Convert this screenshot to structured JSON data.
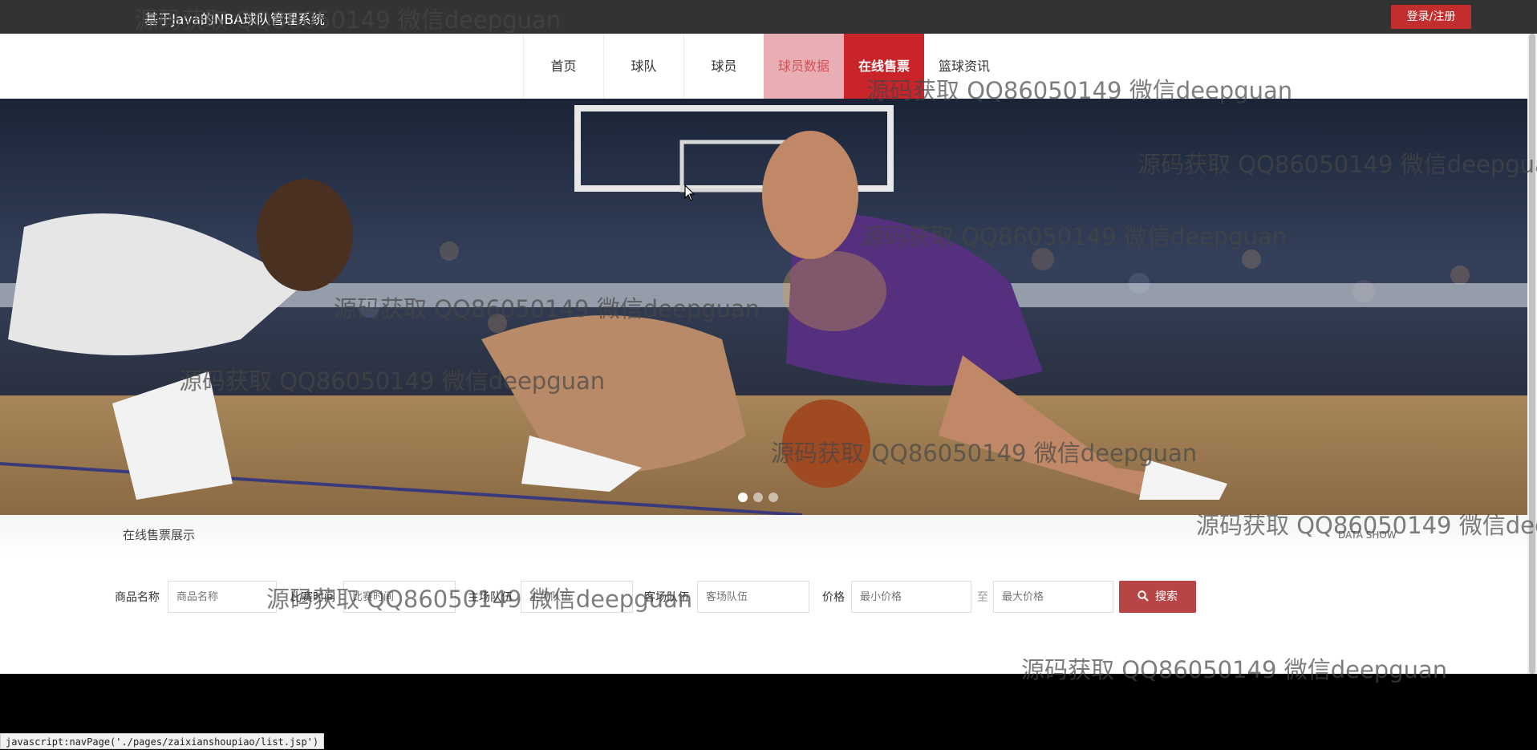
{
  "header": {
    "title": "基于Java的NBA球队管理系统",
    "login_label": "登录/注册"
  },
  "nav": {
    "items": [
      "首页",
      "球队",
      "球员",
      "球员数据",
      "在线售票",
      "篮球资讯"
    ],
    "active_index": 4
  },
  "section": {
    "title": "在线售票展示",
    "subtitle_en": "DATA SHOW"
  },
  "search": {
    "product_name_label": "商品名称",
    "product_name_placeholder": "商品名称",
    "match_time_label": "比赛时间",
    "match_time_placeholder": "比赛时间",
    "home_team_label": "主场队伍",
    "home_team_placeholder": "主场队伍",
    "away_team_label": "客场队伍",
    "away_team_placeholder": "客场队伍",
    "price_label": "价格",
    "min_price_placeholder": "最小价格",
    "to_label": "至",
    "max_price_placeholder": "最大价格",
    "search_label": "搜索"
  },
  "carousel": {
    "slide_count": 3,
    "active_index": 0
  },
  "watermark": "源码获取 QQ86050149 微信deepguan",
  "status_bar": "javascript:navPage('./pages/zaixianshoupiao/list.jsp')",
  "colors": {
    "header_bg": "#333333",
    "accent_red": "#c8242a",
    "search_btn": "#b84545"
  },
  "icons": {
    "search": "magnifier-icon",
    "cursor": "arrow-cursor-icon"
  }
}
